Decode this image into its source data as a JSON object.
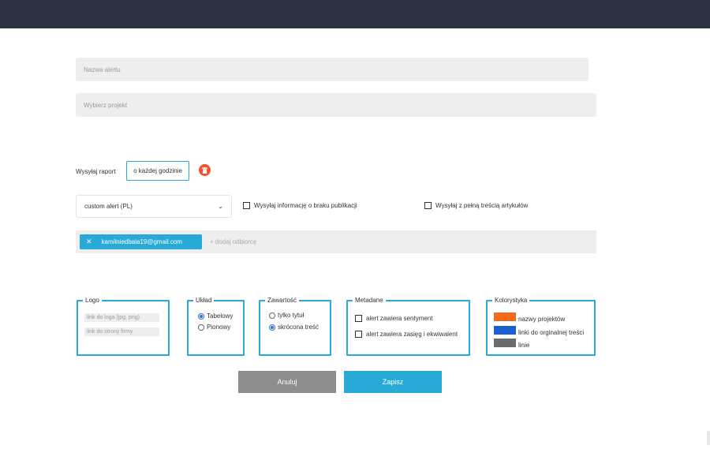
{
  "form": {
    "alert_name_placeholder": "Nazwa alertu",
    "project_placeholder": "Wybierz projekt",
    "send_report_label": "Wysyłaj raport",
    "frequency_value": "o każdej godzinie",
    "template_value": "custom alert (PL)",
    "no_publication_label": "Wysyłaj informację o braku publikacji",
    "full_content_label": "Wysyłaj z pełną treścią artykułów",
    "recipient_email": "kamilniedbala19@gmail.com",
    "add_recipient_placeholder": "+ dodaj odbiorcę"
  },
  "logo": {
    "legend": "Logo",
    "logo_link_placeholder": "link do loga (jpg, png)",
    "company_link_placeholder": "link do strony firmy"
  },
  "layout": {
    "legend": "Układ",
    "options": [
      "Tabelowy",
      "Pionowy"
    ],
    "selected": "Tabelowy"
  },
  "content": {
    "legend": "Zawartość",
    "options": [
      "tylko tytuł",
      "skrócona treść"
    ],
    "selected": "skrócona treść"
  },
  "metadata": {
    "legend": "Metadane",
    "options": [
      "alert zawiera sentyment",
      "alert zawiera zasięg i ekwiwalent"
    ]
  },
  "colors": {
    "legend": "Kolorystyka",
    "items": [
      {
        "label": "nazwy projektów",
        "color": "#f26b1d"
      },
      {
        "label": "linki do orginalnej treści",
        "color": "#1e5fcf"
      },
      {
        "label": "linie",
        "color": "#6b6b6b"
      }
    ]
  },
  "buttons": {
    "cancel": "Anuluj",
    "save": "Zapisz"
  },
  "theme": {
    "accent": "#29a9d8",
    "topbar": "#2b3242",
    "danger": "#f0532d"
  }
}
